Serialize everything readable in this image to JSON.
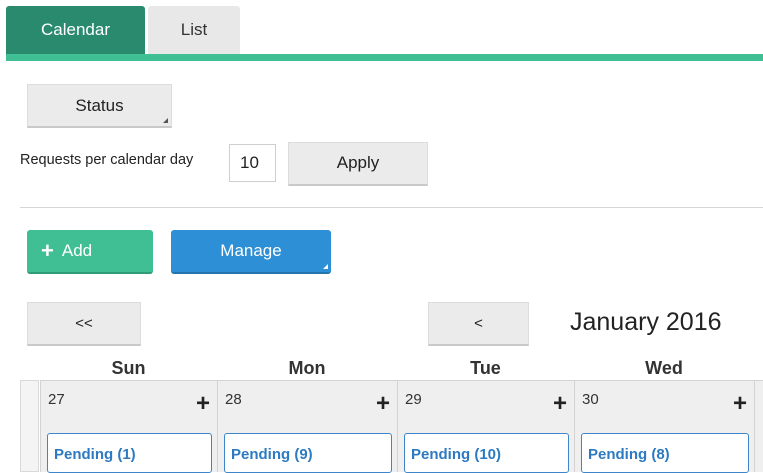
{
  "tabs": [
    {
      "label": "Calendar",
      "active": true
    },
    {
      "label": "List",
      "active": false
    }
  ],
  "filters": {
    "status_label": "Status",
    "requests_label": "Requests per calendar day",
    "requests_value": "10",
    "apply_label": "Apply"
  },
  "actions": {
    "add_label": "Add",
    "manage_label": "Manage"
  },
  "calendar": {
    "prev_prev_label": "<<",
    "prev_label": "<",
    "month_title": "January 2016",
    "days_of_week": [
      "Sun",
      "Mon",
      "Tue",
      "Wed"
    ],
    "days": [
      {
        "num": "27",
        "pending": "Pending (1)"
      },
      {
        "num": "28",
        "pending": "Pending (9)"
      },
      {
        "num": "29",
        "pending": "Pending (10)"
      },
      {
        "num": "30",
        "pending": "Pending (8)"
      }
    ],
    "add_day_symbol": "+"
  },
  "colors": {
    "tab_active": "#2a8a6e",
    "accent_green": "#3fbf93",
    "accent_blue": "#2d8fd6",
    "pending_text": "#2d7ac2"
  }
}
